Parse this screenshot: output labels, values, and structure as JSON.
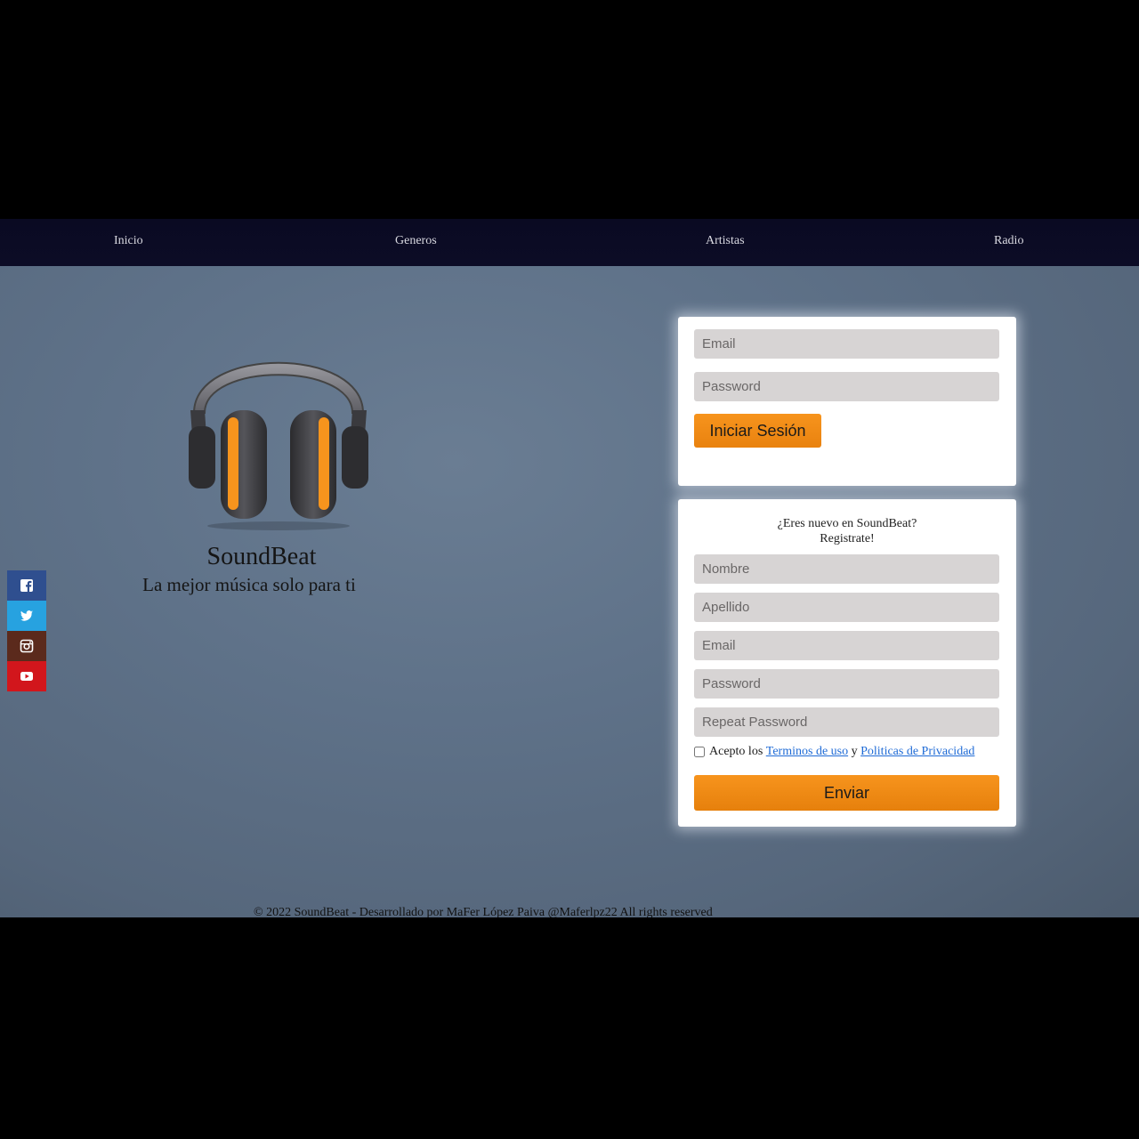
{
  "nav": {
    "items": [
      {
        "label": "Inicio"
      },
      {
        "label": "Generos"
      },
      {
        "label": "Artistas"
      },
      {
        "label": "Radio"
      }
    ]
  },
  "brand": {
    "title": "SoundBeat",
    "tagline": "La mejor música solo para ti",
    "logo_icon": "headphones-icon",
    "accent_color": "#f7941d"
  },
  "social": [
    {
      "icon": "facebook-icon",
      "color": "#2f4f8f"
    },
    {
      "icon": "twitter-icon",
      "color": "#27a2e0"
    },
    {
      "icon": "instagram-icon",
      "color": "#5b2a1c"
    },
    {
      "icon": "youtube-icon",
      "color": "#d2161c"
    }
  ],
  "login": {
    "email_placeholder": "Email",
    "password_placeholder": "Password",
    "submit_label": "Iniciar Sesión"
  },
  "register": {
    "heading_line1": "¿Eres nuevo en SoundBeat?",
    "heading_line2": "Registrate!",
    "nombre_placeholder": "Nombre",
    "apellido_placeholder": "Apellido",
    "email_placeholder": "Email",
    "password_placeholder": "Password",
    "repeat_password_placeholder": "Repeat Password",
    "terms_prefix": "Acepto los",
    "terms_link": "Terminos de uso",
    "terms_and": "y",
    "privacy_link": "Politicas de Privacidad",
    "submit_label": "Enviar"
  },
  "footer": {
    "text": "© 2022 SoundBeat - Desarrollado por MaFer López Paiva @Maferlpz22 All rights reserved"
  }
}
